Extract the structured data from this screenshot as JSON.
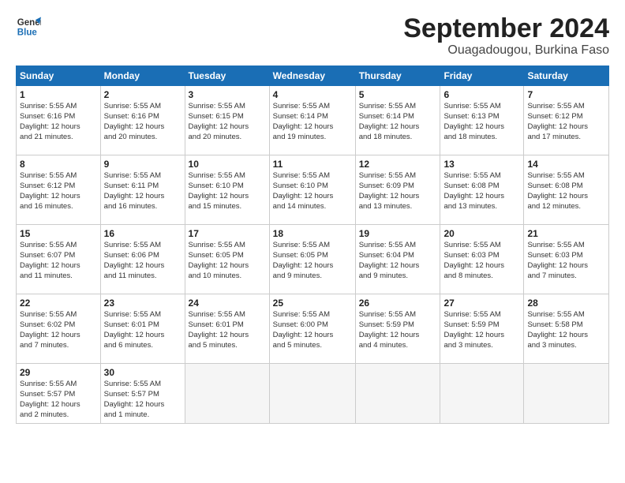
{
  "logo": {
    "line1": "General",
    "line2": "Blue"
  },
  "title": "September 2024",
  "location": "Ouagadougou, Burkina Faso",
  "days_of_week": [
    "Sunday",
    "Monday",
    "Tuesday",
    "Wednesday",
    "Thursday",
    "Friday",
    "Saturday"
  ],
  "weeks": [
    [
      {
        "day": "1",
        "info": "Sunrise: 5:55 AM\nSunset: 6:16 PM\nDaylight: 12 hours\nand 21 minutes."
      },
      {
        "day": "2",
        "info": "Sunrise: 5:55 AM\nSunset: 6:16 PM\nDaylight: 12 hours\nand 20 minutes."
      },
      {
        "day": "3",
        "info": "Sunrise: 5:55 AM\nSunset: 6:15 PM\nDaylight: 12 hours\nand 20 minutes."
      },
      {
        "day": "4",
        "info": "Sunrise: 5:55 AM\nSunset: 6:14 PM\nDaylight: 12 hours\nand 19 minutes."
      },
      {
        "day": "5",
        "info": "Sunrise: 5:55 AM\nSunset: 6:14 PM\nDaylight: 12 hours\nand 18 minutes."
      },
      {
        "day": "6",
        "info": "Sunrise: 5:55 AM\nSunset: 6:13 PM\nDaylight: 12 hours\nand 18 minutes."
      },
      {
        "day": "7",
        "info": "Sunrise: 5:55 AM\nSunset: 6:12 PM\nDaylight: 12 hours\nand 17 minutes."
      }
    ],
    [
      {
        "day": "8",
        "info": "Sunrise: 5:55 AM\nSunset: 6:12 PM\nDaylight: 12 hours\nand 16 minutes."
      },
      {
        "day": "9",
        "info": "Sunrise: 5:55 AM\nSunset: 6:11 PM\nDaylight: 12 hours\nand 16 minutes."
      },
      {
        "day": "10",
        "info": "Sunrise: 5:55 AM\nSunset: 6:10 PM\nDaylight: 12 hours\nand 15 minutes."
      },
      {
        "day": "11",
        "info": "Sunrise: 5:55 AM\nSunset: 6:10 PM\nDaylight: 12 hours\nand 14 minutes."
      },
      {
        "day": "12",
        "info": "Sunrise: 5:55 AM\nSunset: 6:09 PM\nDaylight: 12 hours\nand 13 minutes."
      },
      {
        "day": "13",
        "info": "Sunrise: 5:55 AM\nSunset: 6:08 PM\nDaylight: 12 hours\nand 13 minutes."
      },
      {
        "day": "14",
        "info": "Sunrise: 5:55 AM\nSunset: 6:08 PM\nDaylight: 12 hours\nand 12 minutes."
      }
    ],
    [
      {
        "day": "15",
        "info": "Sunrise: 5:55 AM\nSunset: 6:07 PM\nDaylight: 12 hours\nand 11 minutes."
      },
      {
        "day": "16",
        "info": "Sunrise: 5:55 AM\nSunset: 6:06 PM\nDaylight: 12 hours\nand 11 minutes."
      },
      {
        "day": "17",
        "info": "Sunrise: 5:55 AM\nSunset: 6:05 PM\nDaylight: 12 hours\nand 10 minutes."
      },
      {
        "day": "18",
        "info": "Sunrise: 5:55 AM\nSunset: 6:05 PM\nDaylight: 12 hours\nand 9 minutes."
      },
      {
        "day": "19",
        "info": "Sunrise: 5:55 AM\nSunset: 6:04 PM\nDaylight: 12 hours\nand 9 minutes."
      },
      {
        "day": "20",
        "info": "Sunrise: 5:55 AM\nSunset: 6:03 PM\nDaylight: 12 hours\nand 8 minutes."
      },
      {
        "day": "21",
        "info": "Sunrise: 5:55 AM\nSunset: 6:03 PM\nDaylight: 12 hours\nand 7 minutes."
      }
    ],
    [
      {
        "day": "22",
        "info": "Sunrise: 5:55 AM\nSunset: 6:02 PM\nDaylight: 12 hours\nand 7 minutes."
      },
      {
        "day": "23",
        "info": "Sunrise: 5:55 AM\nSunset: 6:01 PM\nDaylight: 12 hours\nand 6 minutes."
      },
      {
        "day": "24",
        "info": "Sunrise: 5:55 AM\nSunset: 6:01 PM\nDaylight: 12 hours\nand 5 minutes."
      },
      {
        "day": "25",
        "info": "Sunrise: 5:55 AM\nSunset: 6:00 PM\nDaylight: 12 hours\nand 5 minutes."
      },
      {
        "day": "26",
        "info": "Sunrise: 5:55 AM\nSunset: 5:59 PM\nDaylight: 12 hours\nand 4 minutes."
      },
      {
        "day": "27",
        "info": "Sunrise: 5:55 AM\nSunset: 5:59 PM\nDaylight: 12 hours\nand 3 minutes."
      },
      {
        "day": "28",
        "info": "Sunrise: 5:55 AM\nSunset: 5:58 PM\nDaylight: 12 hours\nand 3 minutes."
      }
    ],
    [
      {
        "day": "29",
        "info": "Sunrise: 5:55 AM\nSunset: 5:57 PM\nDaylight: 12 hours\nand 2 minutes."
      },
      {
        "day": "30",
        "info": "Sunrise: 5:55 AM\nSunset: 5:57 PM\nDaylight: 12 hours\nand 1 minute."
      },
      null,
      null,
      null,
      null,
      null
    ]
  ]
}
